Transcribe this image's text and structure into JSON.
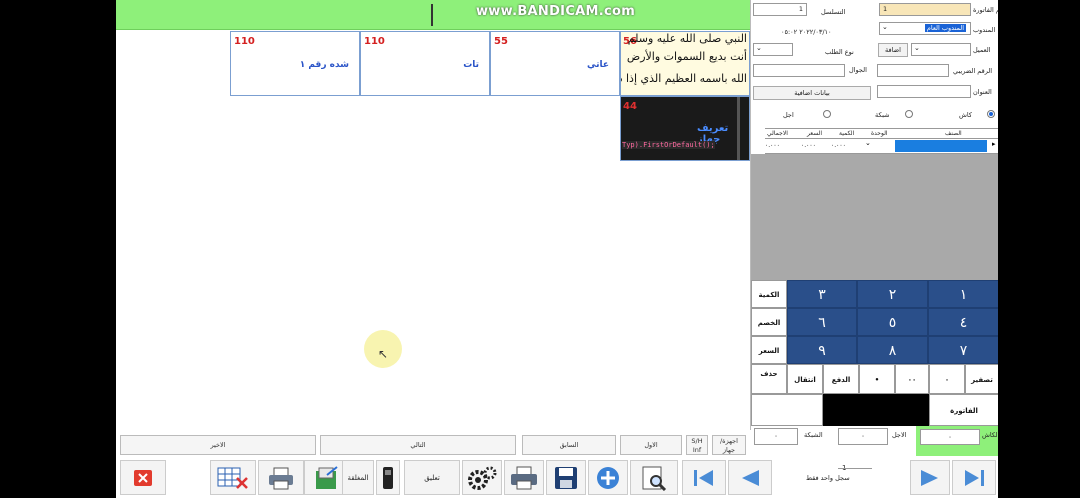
{
  "watermark": "www.BANDICAM.com",
  "tiles": [
    {
      "price": "110",
      "name": "شده رقم ١"
    },
    {
      "price": "110",
      "name": "تات"
    },
    {
      "price": "55",
      "name": "عاتي"
    }
  ],
  "tile_text": {
    "price": "56",
    "lines": [
      "النبي صلى الله عليه وسلم",
      "أنت بديع السموات والأرض",
      "الله باسمه العظيم الذي إذا د"
    ]
  },
  "tile_code": {
    "price": "44",
    "name": "تعريف جهاز",
    "code": "Typ).FirstOrDefault();"
  },
  "invoice": {
    "invoice_no_label": "رقم الفاتورة",
    "invoice_no": "1",
    "serial_label": "التسلسل",
    "serial_value": "1",
    "rep_label": "المندوب",
    "rep_value": "المندوب العام",
    "date_value": "٢٠٢٢/٠٣/١٠ ٠٥:٠٢",
    "customer_label": "العميل",
    "add_label": "اضافة",
    "order_type_label": "نوع الطلب",
    "tax_no_label": "الرقم الضريبي",
    "mobile_label": "الجوال",
    "address_label": "العنوان",
    "extra_label": "بيانات اضافية",
    "pay_cash": "كاش",
    "pay_network": "شبكة",
    "pay_credit": "اجل"
  },
  "grid": {
    "headers": [
      "الصنف",
      "الوحدة",
      "الكمية",
      "السعر",
      "الاجمالي"
    ],
    "row": [
      "",
      "",
      "٠.٠٠٠",
      "٠.٠٠٠",
      "٠.٠٠٠"
    ]
  },
  "keypad": {
    "digits": [
      [
        "١",
        "٢",
        "٣"
      ],
      [
        "٤",
        "٥",
        "٦"
      ],
      [
        "٧",
        "٨",
        "٩"
      ]
    ],
    "qty": "الكمية",
    "discount": "الخصم",
    "price": "السعر",
    "clear": "تصفير",
    "dot": "•",
    "zeros": "٠٠",
    "zero": "٠",
    "pay": "الدفع",
    "cut": "انتقال",
    "delete": "حذف",
    "invoices": "الفاتورة"
  },
  "nav": {
    "last": "الاخير",
    "next": "التالي",
    "prev": "السابق",
    "first": "الاول",
    "sh_inf": "S/H Inf",
    "device": "اجهزة/ جهاز"
  },
  "totals": {
    "cash_label": "الكاش",
    "cash_value": "٠",
    "credit_label": "الاجل",
    "credit_value": "٠",
    "network_label": "الشبكة",
    "network_value": "٠"
  },
  "toolbar": {
    "closed_label": "المغلقة",
    "suspend_label": "تعليق",
    "record_text": "سجل واحد فقط",
    "record_no": "1"
  },
  "colors": {
    "accent_green": "#8ef07a",
    "keypad_blue": "#2a4f8a",
    "selected": "#1a63d6"
  }
}
